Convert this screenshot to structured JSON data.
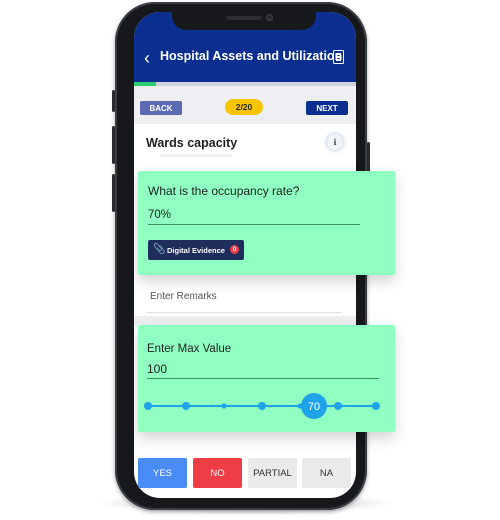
{
  "header": {
    "title": "Hospital Assets and Utilization",
    "back_icon": "chevron-left-icon",
    "doc_icon": "document-icon"
  },
  "progress": {
    "fraction": 0.1,
    "color": "#2ecc71"
  },
  "nav": {
    "back_label": "BACK",
    "next_label": "NEXT",
    "page_indicator": "2/20"
  },
  "section": {
    "title": "Wards capacity",
    "info_icon": "info-icon"
  },
  "question": {
    "text": "What is the occupancy rate?",
    "answer": "70%",
    "evidence_label": "Digital Evidence",
    "evidence_count": "0"
  },
  "remarks": {
    "placeholder": "Enter Remarks"
  },
  "max_value": {
    "label": "Enter Max Value",
    "value": "100",
    "slider_value": "70",
    "slider_ticks": 7,
    "slider_selected_index": 4
  },
  "answers": [
    {
      "label": "YES",
      "color": "#4a8cf7"
    },
    {
      "label": "NO",
      "color": "#ef3d46"
    },
    {
      "label": "PARTIAL",
      "color": "#eaeaea"
    },
    {
      "label": "NA",
      "color": "#eaeaea"
    }
  ],
  "colors": {
    "brand": "#0b2e91",
    "card": "#8fffc2",
    "slider": "#1fa3e8",
    "accent_yellow": "#f7c400"
  }
}
